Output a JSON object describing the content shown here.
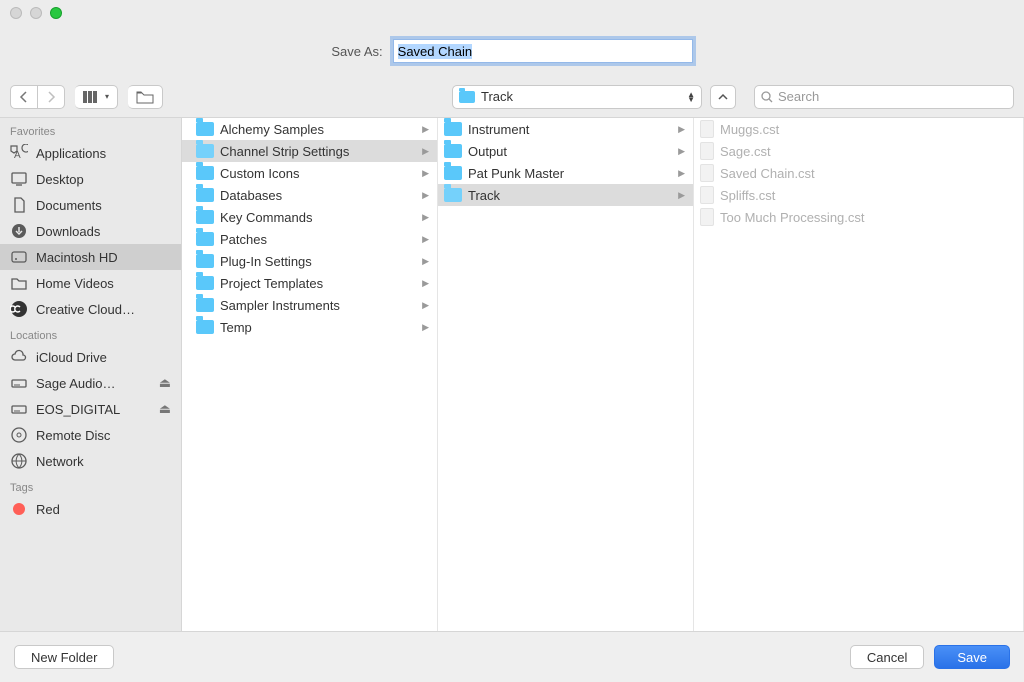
{
  "save_as_label": "Save As:",
  "filename": "Saved Chain",
  "path_popup": {
    "folder_label": "Track"
  },
  "search": {
    "placeholder": "Search"
  },
  "sidebar": {
    "sections": [
      {
        "title": "Favorites",
        "items": [
          {
            "label": "Applications",
            "icon": "apps"
          },
          {
            "label": "Desktop",
            "icon": "desktop"
          },
          {
            "label": "Documents",
            "icon": "documents"
          },
          {
            "label": "Downloads",
            "icon": "downloads"
          },
          {
            "label": "Macintosh HD",
            "icon": "hdd",
            "selected": true
          },
          {
            "label": "Home Videos",
            "icon": "folder"
          },
          {
            "label": "Creative Cloud…",
            "icon": "cc"
          }
        ]
      },
      {
        "title": "Locations",
        "items": [
          {
            "label": "iCloud Drive",
            "icon": "cloud"
          },
          {
            "label": "Sage Audio…",
            "icon": "drive",
            "eject": true
          },
          {
            "label": "EOS_DIGITAL",
            "icon": "drive",
            "eject": true
          },
          {
            "label": "Remote Disc",
            "icon": "disc"
          },
          {
            "label": "Network",
            "icon": "network"
          }
        ]
      },
      {
        "title": "Tags",
        "items": [
          {
            "label": "Red",
            "icon": "tag",
            "color": "#ff5f57"
          }
        ]
      }
    ]
  },
  "columns": [
    {
      "items": [
        {
          "label": "Alchemy Samples",
          "type": "folder",
          "expander": true,
          "arrow": true
        },
        {
          "label": "Channel Strip Settings",
          "type": "folder",
          "selected": true,
          "expander": true,
          "arrow": true
        },
        {
          "label": "Custom Icons",
          "type": "folder",
          "arrow": true
        },
        {
          "label": "Databases",
          "type": "folder",
          "expander": true,
          "arrow": true
        },
        {
          "label": "Key Commands",
          "type": "folder",
          "arrow": true
        },
        {
          "label": "Patches",
          "type": "folder",
          "arrow": true
        },
        {
          "label": "Plug-In Settings",
          "type": "folder",
          "arrow": true
        },
        {
          "label": "Project Templates",
          "type": "folder",
          "arrow": true
        },
        {
          "label": "Sampler Instruments",
          "type": "folder",
          "arrow": true
        },
        {
          "label": "Temp",
          "type": "folder",
          "arrow": true
        }
      ]
    },
    {
      "items": [
        {
          "label": "Instrument",
          "type": "folder",
          "arrow": true
        },
        {
          "label": "Output",
          "type": "folder",
          "arrow": true
        },
        {
          "label": "Pat Punk Master",
          "type": "folder",
          "arrow": true
        },
        {
          "label": "Track",
          "type": "folder",
          "selected": true,
          "arrow": true
        }
      ]
    },
    {
      "items": [
        {
          "label": "Muggs.cst",
          "type": "file",
          "disabled": true
        },
        {
          "label": "Sage.cst",
          "type": "file",
          "disabled": true
        },
        {
          "label": "Saved Chain.cst",
          "type": "file",
          "disabled": true
        },
        {
          "label": "Spliffs.cst",
          "type": "file",
          "disabled": true
        },
        {
          "label": "Too Much Processing.cst",
          "type": "file",
          "disabled": true
        }
      ]
    }
  ],
  "buttons": {
    "new_folder": "New Folder",
    "cancel": "Cancel",
    "save": "Save"
  }
}
